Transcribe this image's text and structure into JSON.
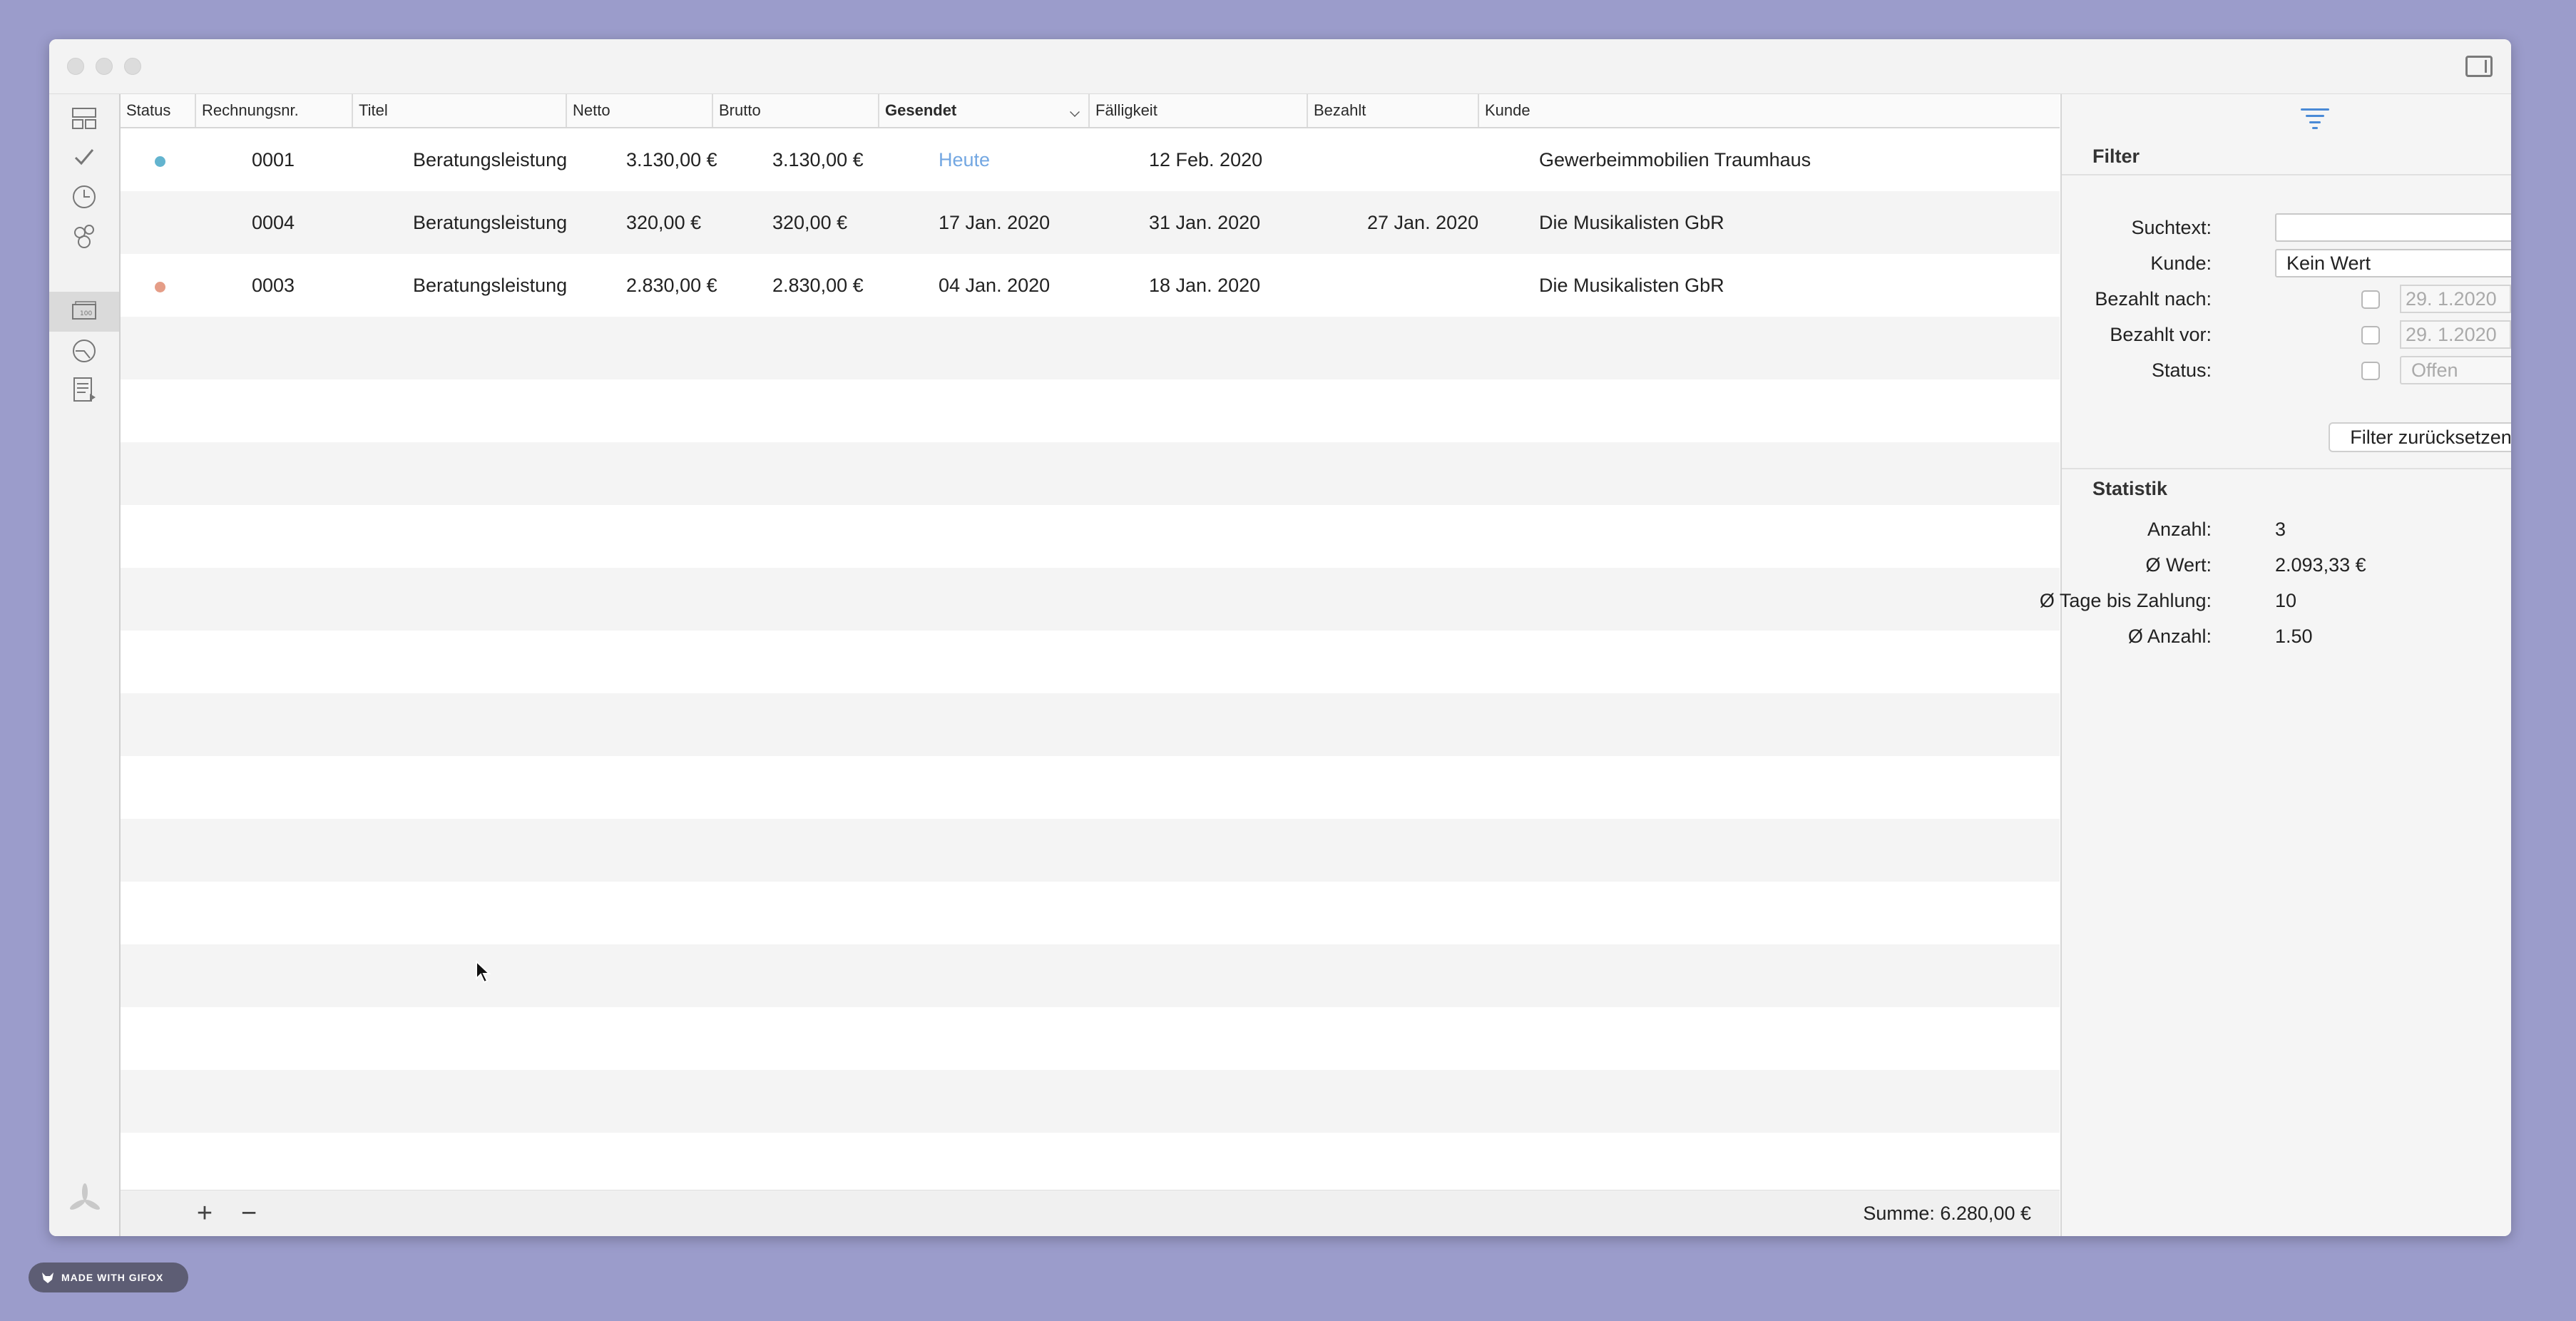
{
  "table": {
    "columns": [
      "Status",
      "Rechnungsnr.",
      "Titel",
      "Netto",
      "Brutto",
      "Gesendet",
      "Fälligkeit",
      "Bezahlt",
      "Kunde"
    ],
    "rows": [
      {
        "status_color": "#63b4cf",
        "nr": "0001",
        "titel": "Beratungsleistung",
        "netto": "3.130,00 €",
        "brutto": "3.130,00 €",
        "gesendet": "Heute",
        "faelligkeit": "12 Feb. 2020",
        "bezahlt": "",
        "kunde": "Gewerbeimmobilien Traumhaus"
      },
      {
        "status_color": "",
        "nr": "0004",
        "titel": "Beratungsleistung",
        "netto": "320,00 €",
        "brutto": "320,00 €",
        "gesendet": "17 Jan. 2020",
        "faelligkeit": "31 Jan. 2020",
        "bezahlt": "27 Jan. 2020",
        "kunde": "Die Musikalisten GbR"
      },
      {
        "status_color": "#e59d87",
        "nr": "0003",
        "titel": "Beratungsleistung",
        "netto": "2.830,00 €",
        "brutto": "2.830,00 €",
        "gesendet": "04 Jan. 2020",
        "faelligkeit": "18 Jan. 2020",
        "bezahlt": "",
        "kunde": "Die Musikalisten GbR"
      }
    ],
    "footer": {
      "add": "+",
      "remove": "−",
      "sum": "Summe: 6.280,00 €"
    }
  },
  "filter": {
    "title": "Filter",
    "suchtext_label": "Suchtext:",
    "suchtext_value": "",
    "kunde_label": "Kunde:",
    "kunde_value": "Kein Wert",
    "bezahlt_nach_label": "Bezahlt nach:",
    "bezahlt_nach_value": "29.  1.2020",
    "bezahlt_vor_label": "Bezahlt vor:",
    "bezahlt_vor_value": "29.  1.2020",
    "status_label": "Status:",
    "status_value": "Offen",
    "reset_label": "Filter zurücksetzen"
  },
  "statistik": {
    "title": "Statistik",
    "anzahl_label": "Anzahl:",
    "anzahl_value": "3",
    "wert_label": "Ø Wert:",
    "wert_value": "2.093,33 €",
    "tage_label": "Ø Tage bis Zahlung:",
    "tage_value": "10",
    "avg_anzahl_label": "Ø Anzahl:",
    "avg_anzahl_value": "1.50"
  },
  "badge": {
    "text": "MADE WITH GIFOX"
  },
  "icons": {
    "nav": [
      "dashboard-icon",
      "tasks-check-icon",
      "time-clock-icon",
      "clients-icon",
      "invoices-icon",
      "reports-icon",
      "documents-icon"
    ],
    "logo": "app-logo-icon",
    "filter": "filter-lines-icon",
    "sidebar_toggle": "sidebar-toggle-icon"
  }
}
